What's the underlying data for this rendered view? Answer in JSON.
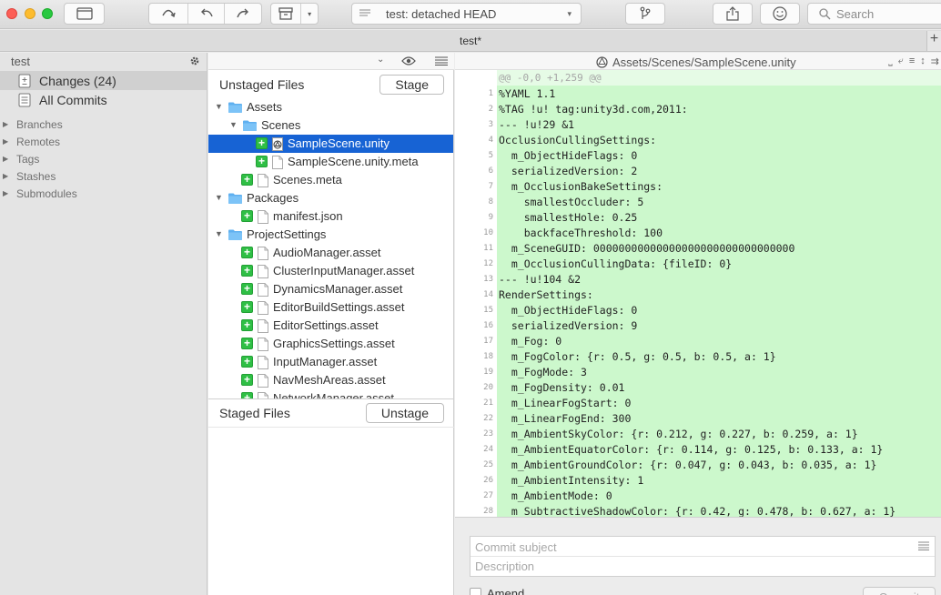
{
  "toolbar": {
    "branch_select": "test: detached HEAD",
    "search_placeholder": "Search"
  },
  "tab": {
    "title": "test*",
    "add": "+"
  },
  "sidebar": {
    "repo": "test",
    "changes": "Changes (24)",
    "all_commits": "All Commits",
    "groups": [
      "Branches",
      "Remotes",
      "Tags",
      "Stashes",
      "Submodules"
    ]
  },
  "files": {
    "unstaged_title": "Unstaged Files",
    "stage_button": "Stage",
    "staged_title": "Staged Files",
    "unstage_button": "Unstage",
    "tree": [
      {
        "label": "Assets",
        "kind": "folder",
        "depth": 0
      },
      {
        "label": "Scenes",
        "kind": "folder",
        "depth": 1
      },
      {
        "label": "SampleScene.unity",
        "kind": "unity",
        "depth": 2,
        "selected": true
      },
      {
        "label": "SampleScene.unity.meta",
        "kind": "file",
        "depth": 2
      },
      {
        "label": "Scenes.meta",
        "kind": "file",
        "depth": 1
      },
      {
        "label": "Packages",
        "kind": "folder",
        "depth": 0
      },
      {
        "label": "manifest.json",
        "kind": "file",
        "depth": 1
      },
      {
        "label": "ProjectSettings",
        "kind": "folder",
        "depth": 0
      },
      {
        "label": "AudioManager.asset",
        "kind": "file",
        "depth": 1
      },
      {
        "label": "ClusterInputManager.asset",
        "kind": "file",
        "depth": 1
      },
      {
        "label": "DynamicsManager.asset",
        "kind": "file",
        "depth": 1
      },
      {
        "label": "EditorBuildSettings.asset",
        "kind": "file",
        "depth": 1
      },
      {
        "label": "EditorSettings.asset",
        "kind": "file",
        "depth": 1
      },
      {
        "label": "GraphicsSettings.asset",
        "kind": "file",
        "depth": 1
      },
      {
        "label": "InputManager.asset",
        "kind": "file",
        "depth": 1
      },
      {
        "label": "NavMeshAreas.asset",
        "kind": "file",
        "depth": 1
      },
      {
        "label": "NetworkManager.asset",
        "kind": "file",
        "depth": 1
      }
    ]
  },
  "diff": {
    "path": "Assets/Scenes/SampleScene.unity",
    "hunk": "@@ -0,0 +1,259 @@",
    "lines": [
      "%YAML 1.1",
      "%TAG !u! tag:unity3d.com,2011:",
      "--- !u!29 &1",
      "OcclusionCullingSettings:",
      "  m_ObjectHideFlags: 0",
      "  serializedVersion: 2",
      "  m_OcclusionBakeSettings:",
      "    smallestOccluder: 5",
      "    smallestHole: 0.25",
      "    backfaceThreshold: 100",
      "  m_SceneGUID: 00000000000000000000000000000000",
      "  m_OcclusionCullingData: {fileID: 0}",
      "--- !u!104 &2",
      "RenderSettings:",
      "  m_ObjectHideFlags: 0",
      "  serializedVersion: 9",
      "  m_Fog: 0",
      "  m_FogColor: {r: 0.5, g: 0.5, b: 0.5, a: 1}",
      "  m_FogMode: 3",
      "  m_FogDensity: 0.01",
      "  m_LinearFogStart: 0",
      "  m_LinearFogEnd: 300",
      "  m_AmbientSkyColor: {r: 0.212, g: 0.227, b: 0.259, a: 1}",
      "  m_AmbientEquatorColor: {r: 0.114, g: 0.125, b: 0.133, a: 1}",
      "  m_AmbientGroundColor: {r: 0.047, g: 0.043, b: 0.035, a: 1}",
      "  m_AmbientIntensity: 1",
      "  m_AmbientMode: 0",
      "  m_SubtractiveShadowColor: {r: 0.42, g: 0.478, b: 0.627, a: 1}"
    ]
  },
  "commit": {
    "subject_placeholder": "Commit subject",
    "description_placeholder": "Description",
    "amend": "Amend",
    "commit_button": "Commit"
  }
}
